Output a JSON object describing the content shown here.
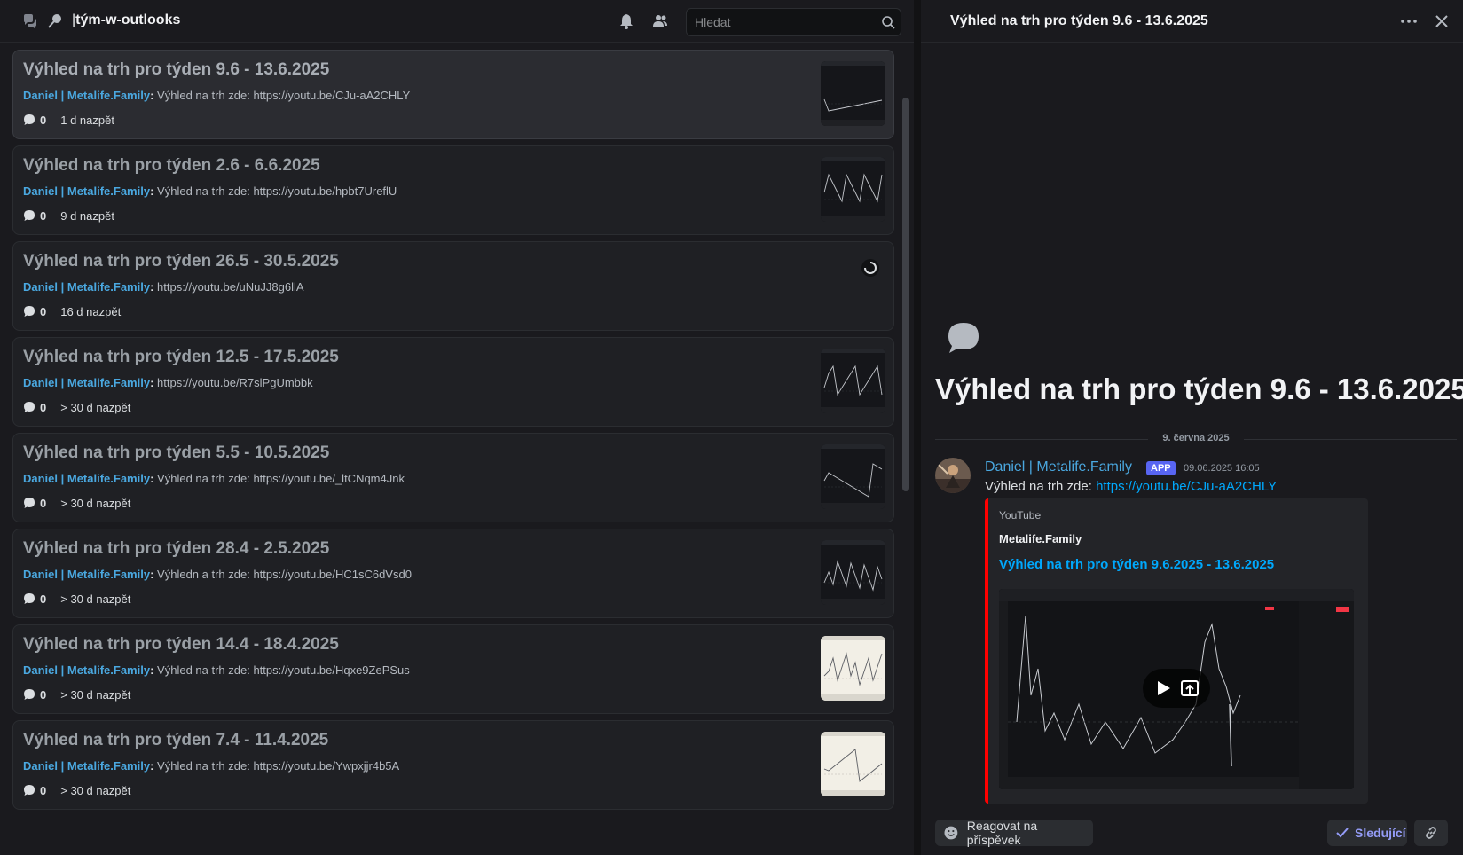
{
  "header": {
    "channel_name": "tým-w-outlooks",
    "search_placeholder": "Hledat"
  },
  "posts": [
    {
      "title": "Výhled na trh pro týden 9.6 - 13.6.2025",
      "author": "Daniel | Metalife.Family",
      "colon": ":",
      "preview": "Výhled na trh zde: https://youtu.be/CJu-aA2CHLY",
      "replies": "0",
      "age": "1 d nazpět",
      "thumb": "dark",
      "active": true
    },
    {
      "title": "Výhled na trh pro týden 2.6 - 6.6.2025",
      "author": "Daniel | Metalife.Family",
      "colon": ":",
      "preview": "Výhled na trh zde: https://youtu.be/hpbt7UreflU",
      "replies": "0",
      "age": "9 d nazpět",
      "thumb": "dark"
    },
    {
      "title": "Výhled na trh pro týden 26.5 - 30.5.2025",
      "author": "Daniel | Metalife.Family",
      "colon": ":",
      "preview": "https://youtu.be/uNuJJ8g6llA",
      "replies": "0",
      "age": "16 d nazpět",
      "thumb": "loading"
    },
    {
      "title": "Výhled na trh pro týden 12.5 - 17.5.2025",
      "author": "Daniel | Metalife.Family",
      "colon": ":",
      "preview": "https://youtu.be/R7slPgUmbbk",
      "replies": "0",
      "age": "> 30 d nazpět",
      "thumb": "dark"
    },
    {
      "title": "Výhled na trh pro týden 5.5 - 10.5.2025",
      "author": "Daniel | Metalife.Family",
      "colon": ":",
      "preview": "Výhled na trh zde: https://youtu.be/_ltCNqm4Jnk",
      "replies": "0",
      "age": "> 30 d nazpět",
      "thumb": "dark"
    },
    {
      "title": "Výhled na trh pro týden 28.4 - 2.5.2025",
      "author": "Daniel | Metalife.Family",
      "colon": ":",
      "preview": "Výhledn a trh zde: https://youtu.be/HC1sC6dVsd0",
      "replies": "0",
      "age": "> 30 d nazpět",
      "thumb": "dark"
    },
    {
      "title": "Výhled na trh pro týden 14.4 - 18.4.2025",
      "author": "Daniel | Metalife.Family",
      "colon": ":",
      "preview": "Výhled na trh zde: https://youtu.be/Hqxe9ZePSus",
      "replies": "0",
      "age": "> 30 d nazpět",
      "thumb": "light"
    },
    {
      "title": "Výhled na trh pro týden 7.4 - 11.4.2025",
      "author": "Daniel | Metalife.Family",
      "colon": ":",
      "preview": "Výhled na trh zde: https://youtu.be/Ywpxjjr4b5A",
      "replies": "0",
      "age": "> 30 d nazpět",
      "thumb": "light"
    }
  ],
  "thread": {
    "header_title": "Výhled na trh pro týden 9.6 - 13.6.2025",
    "heading": "Výhled na trh pro týden 9.6 - 13.6.2025",
    "date_separator": "9. června 2025",
    "message": {
      "author": "Daniel | Metalife.Family",
      "badge": "APP",
      "timestamp": "09.06.2025 16:05",
      "text_prefix": "Výhled na trh zde: ",
      "link": "https://youtu.be/CJu-aA2CHLY"
    },
    "embed": {
      "provider": "YouTube",
      "author": "Metalife.Family",
      "title": "Výhled na trh pro týden 9.6.2025 - 13.6.2025",
      "accent_color": "#ff0000"
    },
    "actions": {
      "react_label": "Reagovat na příspěvek",
      "follow_label": "Sledující"
    }
  },
  "colors": {
    "author": "#4aa8e0",
    "link": "#00a8fc",
    "badge": "#5865f2",
    "follow": "#949cf7"
  },
  "icons": [
    "threads-icon",
    "pin-icon",
    "bell-icon",
    "members-icon",
    "search-icon",
    "more-icon",
    "close-icon",
    "chat-bubble-icon",
    "play-icon",
    "popout-icon",
    "reaction-icon",
    "check-icon",
    "link-icon",
    "loading-spinner-icon"
  ]
}
